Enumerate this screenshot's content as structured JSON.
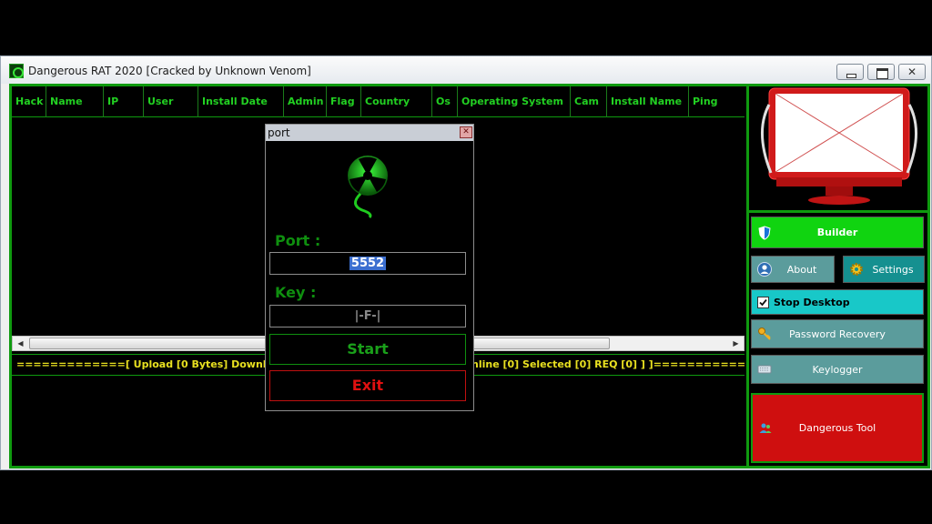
{
  "window": {
    "title": "Dangerous RAT 2020 [Cracked by Unknown Venom]",
    "close_glyph": "✕"
  },
  "list": {
    "columns": [
      {
        "label": "Hack"
      },
      {
        "label": "Name"
      },
      {
        "label": "IP"
      },
      {
        "label": "User"
      },
      {
        "label": "Install Date"
      },
      {
        "label": "Admin"
      },
      {
        "label": "Flag"
      },
      {
        "label": "Country"
      },
      {
        "label": "Os"
      },
      {
        "label": "Operating System"
      },
      {
        "label": "Cam"
      },
      {
        "label": "Install Name"
      },
      {
        "label": "Ping"
      }
    ],
    "scroll_left_glyph": "◀",
    "scroll_right_glyph": "▶"
  },
  "status": {
    "left_text": "=============[  Upload [0 Bytes]  Download",
    "right_text": "nline [0]  Selected [0]  REQ [0]  ]  ]=============="
  },
  "sidebar": {
    "builder_label": "Builder",
    "about_label": "About",
    "settings_label": "Settings",
    "stop_desktop_label": "Stop Desktop",
    "stop_desktop_checked": true,
    "password_recovery_label": "Password Recovery",
    "keylogger_label": "Keylogger",
    "dangerous_tool_label": "Dangerous Tool"
  },
  "dialog": {
    "title": "port",
    "close_glyph": "✕",
    "port_label": "Port :",
    "port_value": "5552",
    "key_label": "Key :",
    "key_value": "|-F-|",
    "start_label": "Start",
    "exit_label": "Exit"
  },
  "colors": {
    "accent_green": "#0f9a0f",
    "header_text": "#22d022",
    "status_text": "#e8e020",
    "exit_red": "#e01010"
  },
  "icons": {
    "app": "radioactive-icon",
    "builder": "shield-icon",
    "about": "user-icon",
    "settings": "gear-icon",
    "password_recovery": "key-icon",
    "keylogger": "keyboard-icon",
    "dangerous_tool": "users-icon"
  }
}
